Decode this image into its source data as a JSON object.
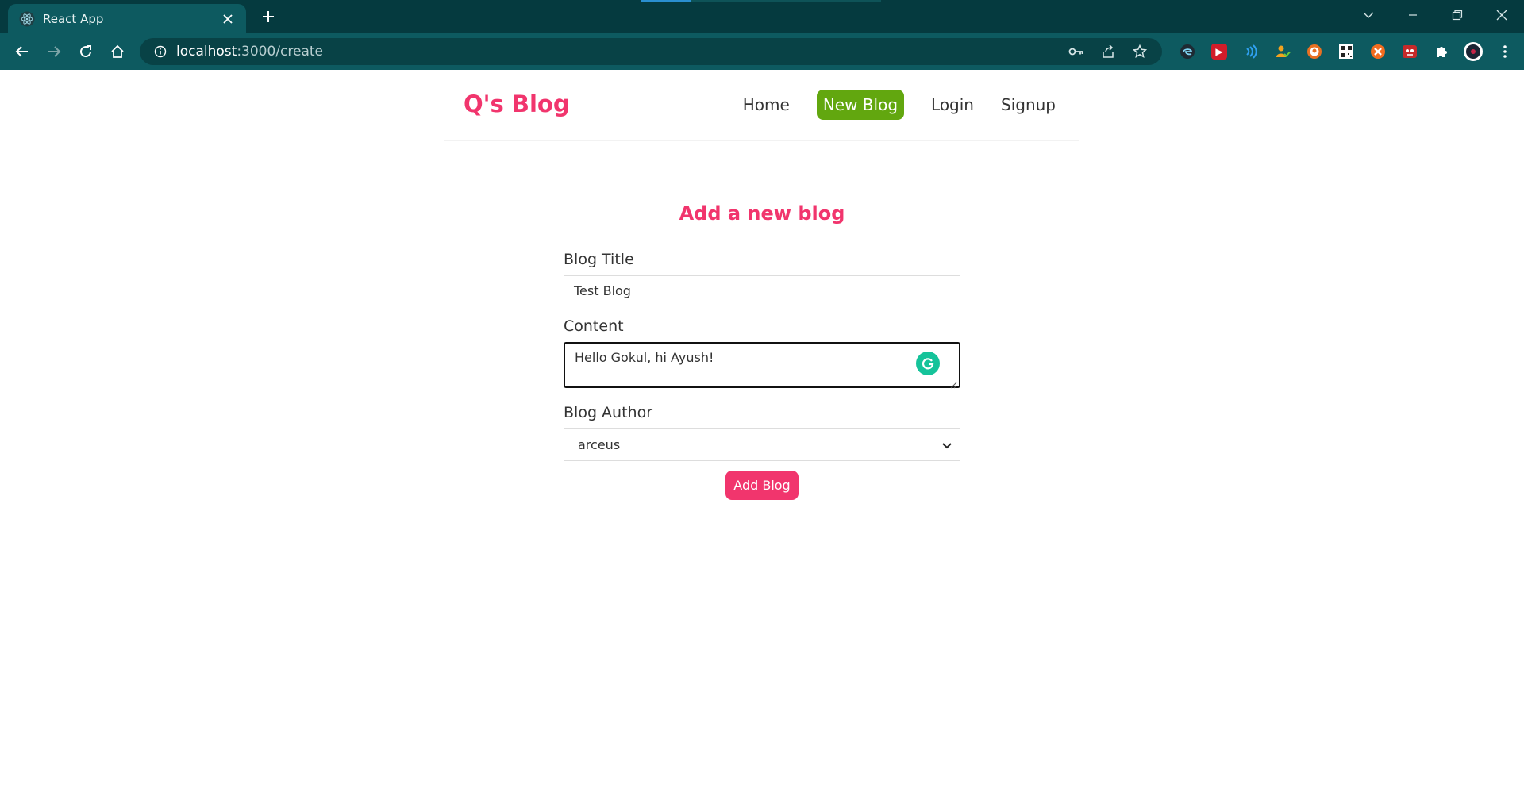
{
  "browser": {
    "tab_title": "React App",
    "url_host": "localhost",
    "url_path": ":3000/create"
  },
  "navbar": {
    "brand": "Q's Blog",
    "links": [
      "Home",
      "New Blog",
      "Login",
      "Signup"
    ]
  },
  "form": {
    "heading": "Add a new blog",
    "title_label": "Blog Title",
    "title_value": "Test Blog",
    "content_label": "Content",
    "content_value": "Hello Gokul, hi Ayush!",
    "author_label": "Blog Author",
    "author_value": "arceus",
    "submit_label": "Add Blog"
  },
  "colors": {
    "brand": "#f1356d",
    "active_nav": "#62a70f",
    "chrome_bg": "#053a3f",
    "toolbar_bg": "#0d5a60"
  }
}
